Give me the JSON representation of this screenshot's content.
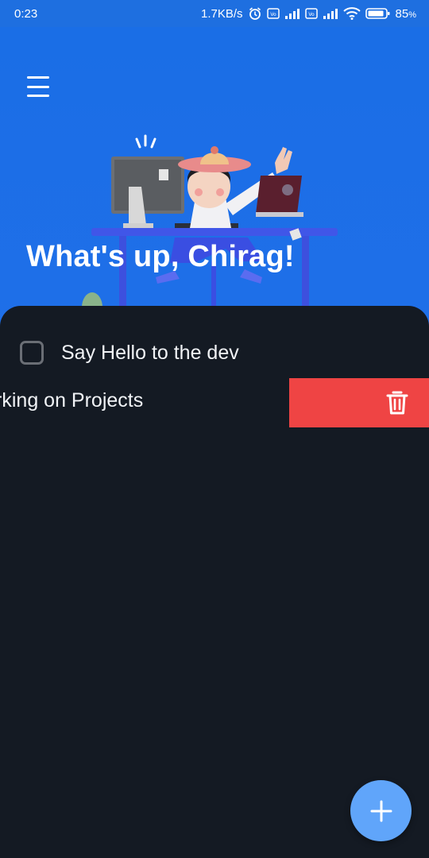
{
  "status_bar": {
    "time": "0:23",
    "network_speed": "1.7KB/s",
    "battery_percent": "85",
    "battery_unit": "%",
    "icons": [
      "alarm-icon",
      "volte-icon",
      "signal-icon",
      "volte-icon",
      "signal-icon",
      "wifi-icon",
      "battery-icon"
    ]
  },
  "header": {
    "menu_icon": "hamburger-menu-icon",
    "greeting": "What's up, Chirag!"
  },
  "tasks": [
    {
      "label": "Say Hello to the dev",
      "checked": false
    },
    {
      "label": "Working on Projects",
      "swiped": true,
      "swipe_action_icon": "trash-icon"
    }
  ],
  "fab": {
    "icon": "plus-icon"
  },
  "colors": {
    "header_bg": "#1e6fe0",
    "sheet_bg": "#141a23",
    "delete_bg": "#ef4444",
    "fab_bg": "#60a5fa"
  }
}
